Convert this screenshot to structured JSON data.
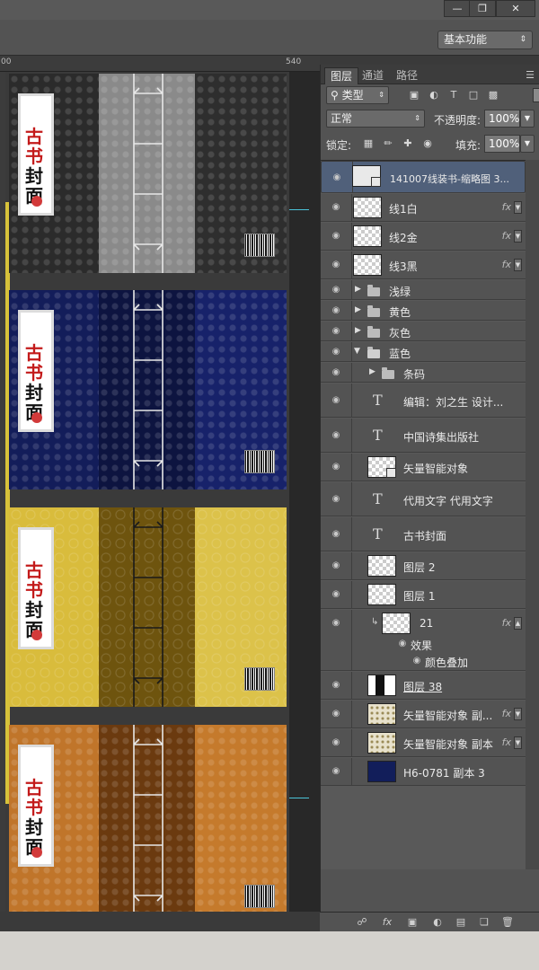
{
  "window": {
    "minimize_icon": "minimize-icon",
    "restore_icon": "restore-icon",
    "close_icon": "close-icon"
  },
  "options_bar": {
    "workspace": "基本功能"
  },
  "ruler": {
    "mark_left": "00",
    "mark_right": "540"
  },
  "covers": [
    {
      "theme": "gray",
      "color": "#2b2b2b",
      "spine": "#8a8a8a"
    },
    {
      "theme": "blue",
      "color": "#131d5a",
      "spine": "#0d1440"
    },
    {
      "theme": "yellow",
      "color": "#d9bc3c",
      "spine": "#6e540e"
    },
    {
      "theme": "orange",
      "color": "#c0752a",
      "spine": "#6b3a0f"
    }
  ],
  "cover_text": {
    "title": "古书封面"
  },
  "layers_panel": {
    "tabs": [
      "图层",
      "通道",
      "路径"
    ],
    "filter_kind": "类型",
    "blend_mode": "正常",
    "opacity_label": "不透明度:",
    "opacity_value": "100%",
    "lock_label": "锁定:",
    "fill_label": "填充:",
    "fill_value": "100%",
    "fx_label": "fx",
    "layers": [
      {
        "name": "141007线装书-缩略图 3...",
        "kind": "smart",
        "selected": true
      },
      {
        "name": "线1白",
        "kind": "pixel",
        "fx": true
      },
      {
        "name": "线2金",
        "kind": "pixel",
        "fx": true
      },
      {
        "name": "线3黑",
        "kind": "pixel",
        "fx": true
      },
      {
        "name": "浅绿",
        "kind": "group"
      },
      {
        "name": "黄色",
        "kind": "group"
      },
      {
        "name": "灰色",
        "kind": "group"
      },
      {
        "name": "蓝色",
        "kind": "group-open"
      },
      {
        "name": "条码",
        "kind": "group-child"
      },
      {
        "name": "编辑：刘之生 设计...",
        "kind": "text"
      },
      {
        "name": "中国诗集出版社",
        "kind": "text"
      },
      {
        "name": "矢量智能对象",
        "kind": "smart"
      },
      {
        "name": "代用文字 代用文字",
        "kind": "text"
      },
      {
        "name": "古书封面",
        "kind": "text"
      },
      {
        "name": "图层 2",
        "kind": "pixel"
      },
      {
        "name": "图层 1",
        "kind": "pixel"
      },
      {
        "name": "21",
        "kind": "clipped",
        "fx": true
      },
      {
        "name": "效果",
        "kind": "effect"
      },
      {
        "name": "颜色叠加",
        "kind": "effect-item"
      },
      {
        "name": "图层 38",
        "kind": "pixel-black"
      },
      {
        "name": "矢量智能对象 副...",
        "kind": "pattern",
        "fx": true
      },
      {
        "name": "矢量智能对象 副本",
        "kind": "pattern",
        "fx": true
      },
      {
        "name": "H6-0781 副本 3",
        "kind": "dark"
      }
    ],
    "footer_icons": [
      "link-icon",
      "fx-icon",
      "mask-icon",
      "adjustment-icon",
      "folder-icon",
      "new-layer-icon",
      "trash-icon"
    ]
  }
}
